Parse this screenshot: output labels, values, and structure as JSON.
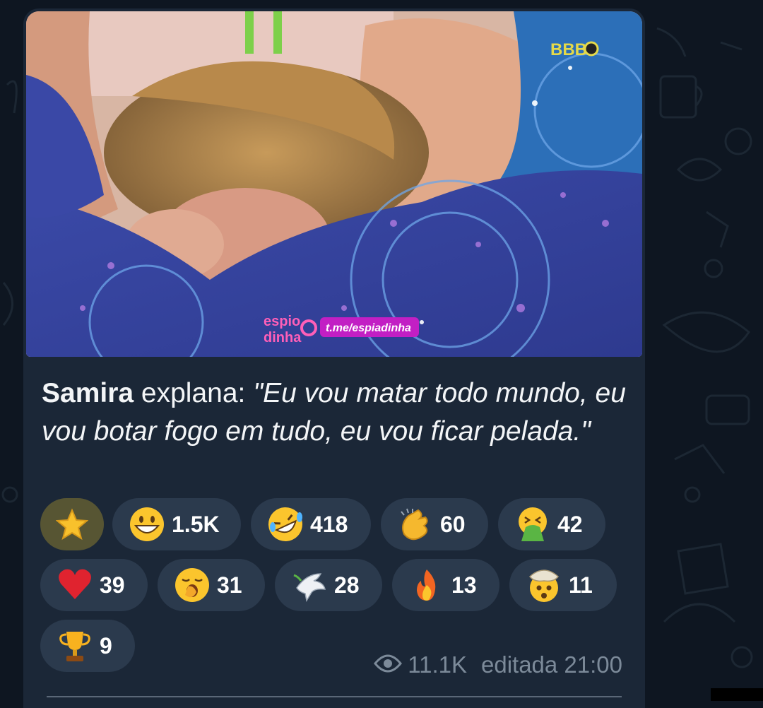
{
  "message": {
    "photo": {
      "watermark_top": "BBB",
      "watermark_logo_line1": "espio",
      "watermark_logo_line2": "dinha",
      "watermark_link": "t.me/espiadinha"
    },
    "caption": {
      "sender": "Samira",
      "verb": " explana: ",
      "quote": "\"Eu vou matar todo mundo, eu vou botar fogo em tudo, eu vou ficar pelada.\""
    },
    "reactions": [
      {
        "emoji": "star",
        "count": "",
        "chosen": true
      },
      {
        "emoji": "grinning-face",
        "count": "1.5K",
        "chosen": false
      },
      {
        "emoji": "rolling-laughing-face",
        "count": "418",
        "chosen": false
      },
      {
        "emoji": "clapping-hands",
        "count": "60",
        "chosen": false
      },
      {
        "emoji": "vomiting-face",
        "count": "42",
        "chosen": false
      },
      {
        "emoji": "red-heart",
        "count": "39",
        "chosen": false
      },
      {
        "emoji": "yawning-face",
        "count": "31",
        "chosen": false
      },
      {
        "emoji": "dove",
        "count": "28",
        "chosen": false
      },
      {
        "emoji": "fire",
        "count": "13",
        "chosen": false
      },
      {
        "emoji": "exploding-head",
        "count": "11",
        "chosen": false
      },
      {
        "emoji": "trophy",
        "count": "9",
        "chosen": false
      }
    ],
    "meta": {
      "eye_icon": "eye-icon",
      "views": "11.1K",
      "edited_time": "editada 21:00"
    }
  },
  "colors": {
    "chat_background": "#0e1621",
    "bubble": "#1b2737",
    "reaction_chip": "#2b3a4d",
    "reaction_chip_chosen": "#575533",
    "meta_text": "#7c8a99"
  }
}
